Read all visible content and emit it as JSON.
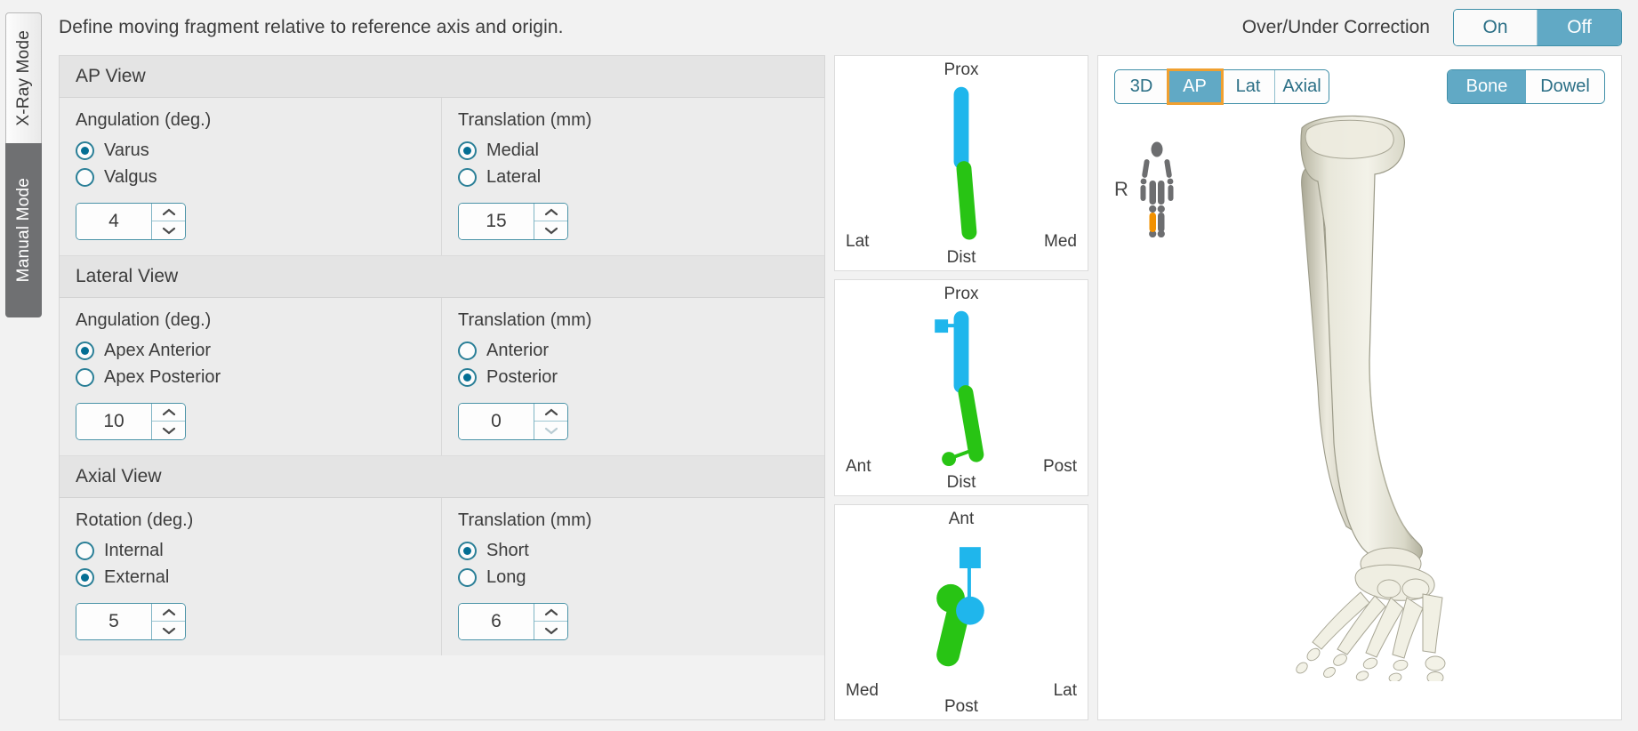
{
  "modes": {
    "items": [
      {
        "id": "xray",
        "label": "X-Ray Mode",
        "active": false
      },
      {
        "id": "manual",
        "label": "Manual Mode",
        "active": true
      }
    ]
  },
  "header": {
    "instruction": "Define moving fragment relative to reference axis and origin.",
    "over_under_label": "Over/Under Correction",
    "over_under_toggle": {
      "options": [
        "On",
        "Off"
      ],
      "selected": "Off"
    }
  },
  "colors": {
    "accent_blue": "#61a9c5",
    "accent_border": "#3f8fa8",
    "radio_teal": "#2a7f97",
    "radio_dot": "#046f94",
    "focus_orange": "#f0a030",
    "proximal_cyan": "#1fb6ec",
    "distal_green": "#28c414",
    "mode_active_gray": "#6f7072",
    "highlight_orange": "#f29100"
  },
  "sections": [
    {
      "id": "ap-view",
      "title": "AP View",
      "left": {
        "title": "Angulation (deg.)",
        "options": [
          {
            "label": "Varus",
            "checked": true
          },
          {
            "label": "Valgus",
            "checked": false
          }
        ],
        "value": "4",
        "up_enabled": true,
        "down_enabled": true
      },
      "right": {
        "title": "Translation (mm)",
        "options": [
          {
            "label": "Medial",
            "checked": true
          },
          {
            "label": "Lateral",
            "checked": false
          }
        ],
        "value": "15",
        "up_enabled": true,
        "down_enabled": true
      }
    },
    {
      "id": "lateral-view",
      "title": "Lateral View",
      "left": {
        "title": "Angulation (deg.)",
        "options": [
          {
            "label": "Apex Anterior",
            "checked": true
          },
          {
            "label": "Apex Posterior",
            "checked": false
          }
        ],
        "value": "10",
        "up_enabled": true,
        "down_enabled": true
      },
      "right": {
        "title": "Translation (mm)",
        "options": [
          {
            "label": "Anterior",
            "checked": false
          },
          {
            "label": "Posterior",
            "checked": true
          }
        ],
        "value": "0",
        "up_enabled": true,
        "down_enabled": false
      }
    },
    {
      "id": "axial-view",
      "title": "Axial View",
      "left": {
        "title": "Rotation (deg.)",
        "options": [
          {
            "label": "Internal",
            "checked": false
          },
          {
            "label": "External",
            "checked": true
          }
        ],
        "value": "5",
        "up_enabled": true,
        "down_enabled": true
      },
      "right": {
        "title": "Translation (mm)",
        "options": [
          {
            "label": "Short",
            "checked": true
          },
          {
            "label": "Long",
            "checked": false
          }
        ],
        "value": "6",
        "up_enabled": true,
        "down_enabled": true
      }
    }
  ],
  "diagrams": [
    {
      "id": "ap-diagram",
      "top": "Prox",
      "bottom": "Dist",
      "left": "Lat",
      "right": "Med"
    },
    {
      "id": "lateral-diagram",
      "top": "Prox",
      "bottom": "Dist",
      "left": "Ant",
      "right": "Post"
    },
    {
      "id": "axial-diagram",
      "top": "Ant",
      "bottom": "Post",
      "left": "Med",
      "right": "Lat"
    }
  ],
  "viewer": {
    "view_tabs": [
      {
        "label": "3D",
        "active": false
      },
      {
        "label": "AP",
        "active": true
      },
      {
        "label": "Lat",
        "active": false
      },
      {
        "label": "Axial",
        "active": false
      }
    ],
    "render_toggle": {
      "options": [
        "Bone",
        "Dowel"
      ],
      "selected": "Bone"
    },
    "orientation_label": "R",
    "model": "tibia-fibula-foot-skeleton"
  }
}
